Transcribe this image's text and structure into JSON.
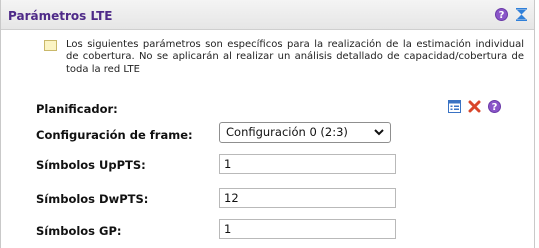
{
  "panel": {
    "title": "Parámetros LTE",
    "header_icons": [
      "help-icon",
      "collapse-icon"
    ]
  },
  "info_note": "Los siguientes parámetros son específicos para la realización de la estimación individual de cobertura. No se aplicarán al realizar un análisis detallado de capacidad/cobertura de toda la red LTE",
  "planificador": {
    "label": "Planificador:",
    "icons": [
      "edit-list-icon",
      "delete-icon",
      "help-icon"
    ]
  },
  "frame_config": {
    "label": "Configuración de frame:",
    "value": "Configuración 0 (2:3)"
  },
  "uppts": {
    "label": "Símbolos UpPTS:",
    "value": "1"
  },
  "dwpts": {
    "label": "Símbolos DwPTS:",
    "value": "12"
  },
  "gp": {
    "label": "Símbolos GP:",
    "value": "1"
  },
  "colors": {
    "title": "#4e2a88",
    "accent": "#8a55c8",
    "delete": "#d9462b"
  }
}
